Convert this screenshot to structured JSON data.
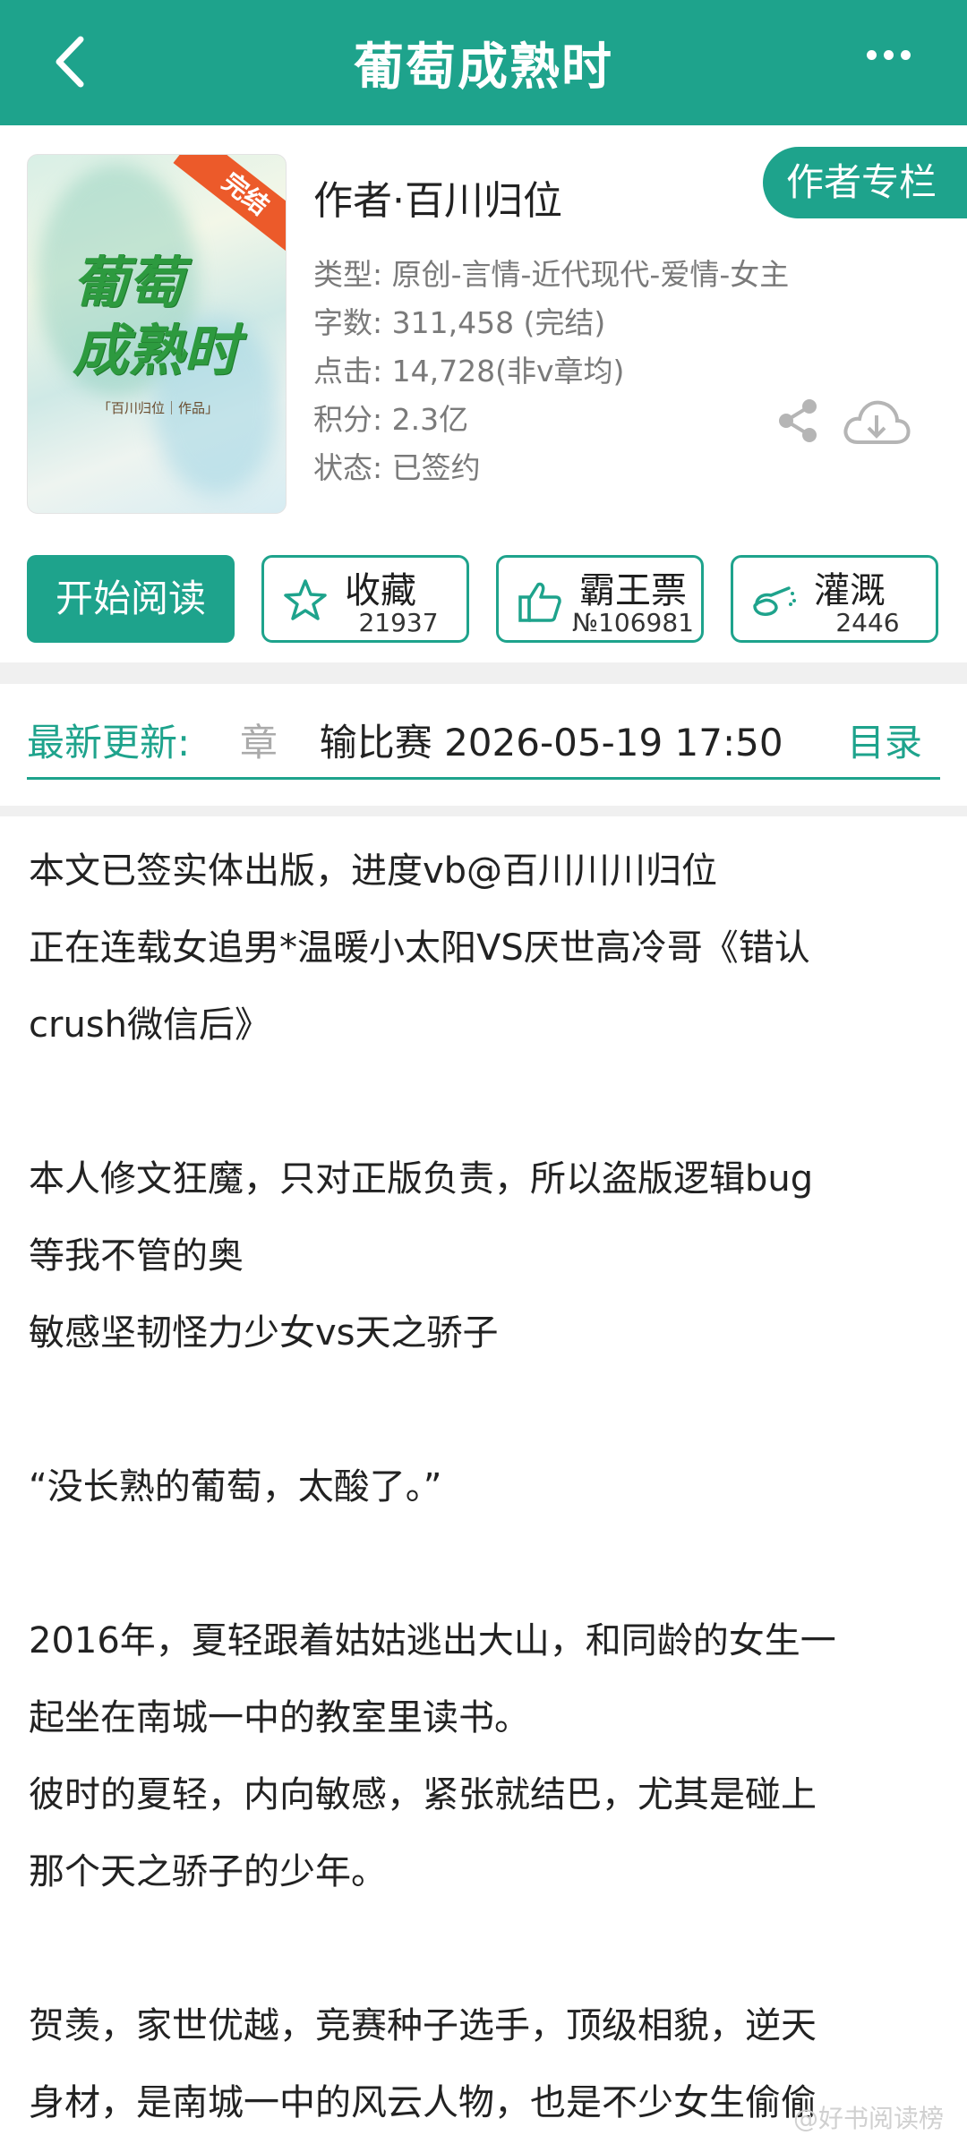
{
  "header": {
    "title": "葡萄成熟时"
  },
  "cover": {
    "title_line1": "葡萄",
    "title_line2": "成熟时",
    "author_mark": "「百川归位｜作品」",
    "ribbon": "完结"
  },
  "book": {
    "author": "作者·百川归位",
    "author_column_button": "作者专栏",
    "type": "类型: 原创-言情-近代现代-爱情-女主",
    "word_count": "字数: 311,458 (完结)",
    "clicks": "点击: 14,728(非v章均)",
    "score": "积分: 2.3亿",
    "status": "状态: 已签约"
  },
  "actions": {
    "read": "开始阅读",
    "favorite": {
      "label": "收藏",
      "count": "21937"
    },
    "vote": {
      "label": "霸王票",
      "count": "№106981"
    },
    "water": {
      "label": "灌溉",
      "count": "2446"
    }
  },
  "update": {
    "label": "最新更新:",
    "partial_char": "章",
    "text": "输比赛  2026-05-19 17:50",
    "catalog": "目录"
  },
  "synopsis": [
    "本文已签实体出版，进度vb@百川川川归位",
    "正在连载女追男*温暖小太阳VS厌世高冷哥《错认",
    "crush微信后》",
    "",
    "本人修文狂魔，只对正版负责，所以盗版逻辑bug",
    "等我不管的奥",
    "敏感坚韧怪力少女vs天之骄子",
    "",
    "“没长熟的葡萄，太酸了。”",
    "",
    "2016年，夏轻跟着姑姑逃出大山，和同龄的女生一",
    "起坐在南城一中的教室里读书。",
    "彼时的夏轻，内向敏感，紧张就结巴，尤其是碰上",
    "那个天之骄子的少年。",
    "",
    "贺羡，家世优越，竞赛种子选手，顶级相貌，逆天",
    "身材，是南城一中的风云人物，也是不少女生偷偷"
  ],
  "watermark": "@好书阅读榜",
  "colors": {
    "accent": "#1ea38c",
    "ribbon": "#ec5a2a"
  },
  "icons": [
    "back-icon",
    "more-icon",
    "share-icon",
    "download-icon",
    "star-icon",
    "thumbs-up-icon",
    "watering-can-icon"
  ]
}
